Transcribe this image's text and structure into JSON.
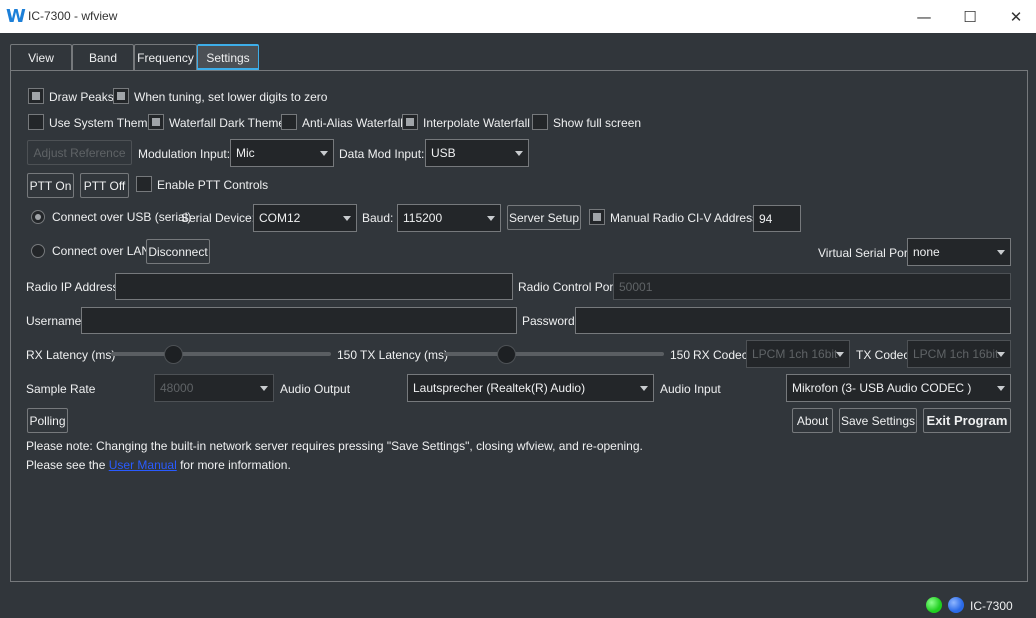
{
  "window": {
    "title": "IC-7300 - wfview",
    "logo": "W",
    "min": "—",
    "max": "☐",
    "close": "✕"
  },
  "tabs": [
    "View",
    "Band",
    "Frequency",
    "Settings"
  ],
  "settings": {
    "draw_peaks": "Draw Peaks",
    "lower_digits_zero": "When tuning, set lower digits to zero",
    "use_system_theme": "Use System Theme",
    "waterfall_dark_theme": "Waterfall Dark Theme",
    "anti_alias_waterfall": "Anti-Alias Waterfall",
    "interpolate_waterfall": "Interpolate Waterfall",
    "show_full_screen": "Show full screen",
    "adjust_reference": "Adjust Reference",
    "modulation_input_label": "Modulation Input:",
    "modulation_input_value": "Mic",
    "data_mod_input_label": "Data Mod Input:",
    "data_mod_input_value": "USB",
    "ptt_on": "PTT On",
    "ptt_off": "PTT Off",
    "enable_ptt_controls": "Enable PTT Controls",
    "connect_usb": "Connect over USB (serial)",
    "serial_device_label": "Serial Device:",
    "serial_device_value": "COM12",
    "baud_label": "Baud:",
    "baud_value": "115200",
    "server_setup": "Server Setup",
    "manual_civ_label": "Manual Radio CI-V Address:",
    "manual_civ_value": "94",
    "connect_lan": "Connect over LAN",
    "disconnect": "Disconnect",
    "virtual_serial_port_label": "Virtual Serial Port",
    "virtual_serial_port_value": "none",
    "radio_ip_label": "Radio IP Address",
    "radio_ip_value": "",
    "radio_control_port_label": "Radio Control Port",
    "radio_control_port_value": "50001",
    "username_label": "Username",
    "username_value": "",
    "password_label": "Password",
    "password_value": "",
    "rx_latency_label": "RX Latency (ms)",
    "rx_latency_value": "150",
    "rx_latency_fraction": 0.28,
    "tx_latency_label": "TX Latency (ms)",
    "tx_latency_value": "150",
    "tx_latency_fraction": 0.28,
    "rx_codec_label": "RX Codec",
    "rx_codec_value": "LPCM 1ch 16bit",
    "tx_codec_label": "TX Codec",
    "tx_codec_value": "LPCM 1ch 16bit",
    "sample_rate_label": "Sample Rate",
    "sample_rate_value": "48000",
    "audio_output_label": "Audio Output",
    "audio_output_value": "Lautsprecher (Realtek(R) Audio)",
    "audio_input_label": "Audio Input",
    "audio_input_value": "Mikrofon (3- USB Audio CODEC )",
    "polling": "Polling",
    "about": "About",
    "save_settings": "Save Settings",
    "exit_program": "Exit Program",
    "note1": "Please note: Changing  the built-in network server requires pressing \"Save Settings\", closing wfview, and re-opening.",
    "note2_pre": "Please see the ",
    "note2_link": "User Manual",
    "note2_post": " for more information."
  },
  "status": {
    "radio_name": "IC-7300",
    "led1_color": "#1fcf1f",
    "led2_color": "#2a6ae8"
  }
}
